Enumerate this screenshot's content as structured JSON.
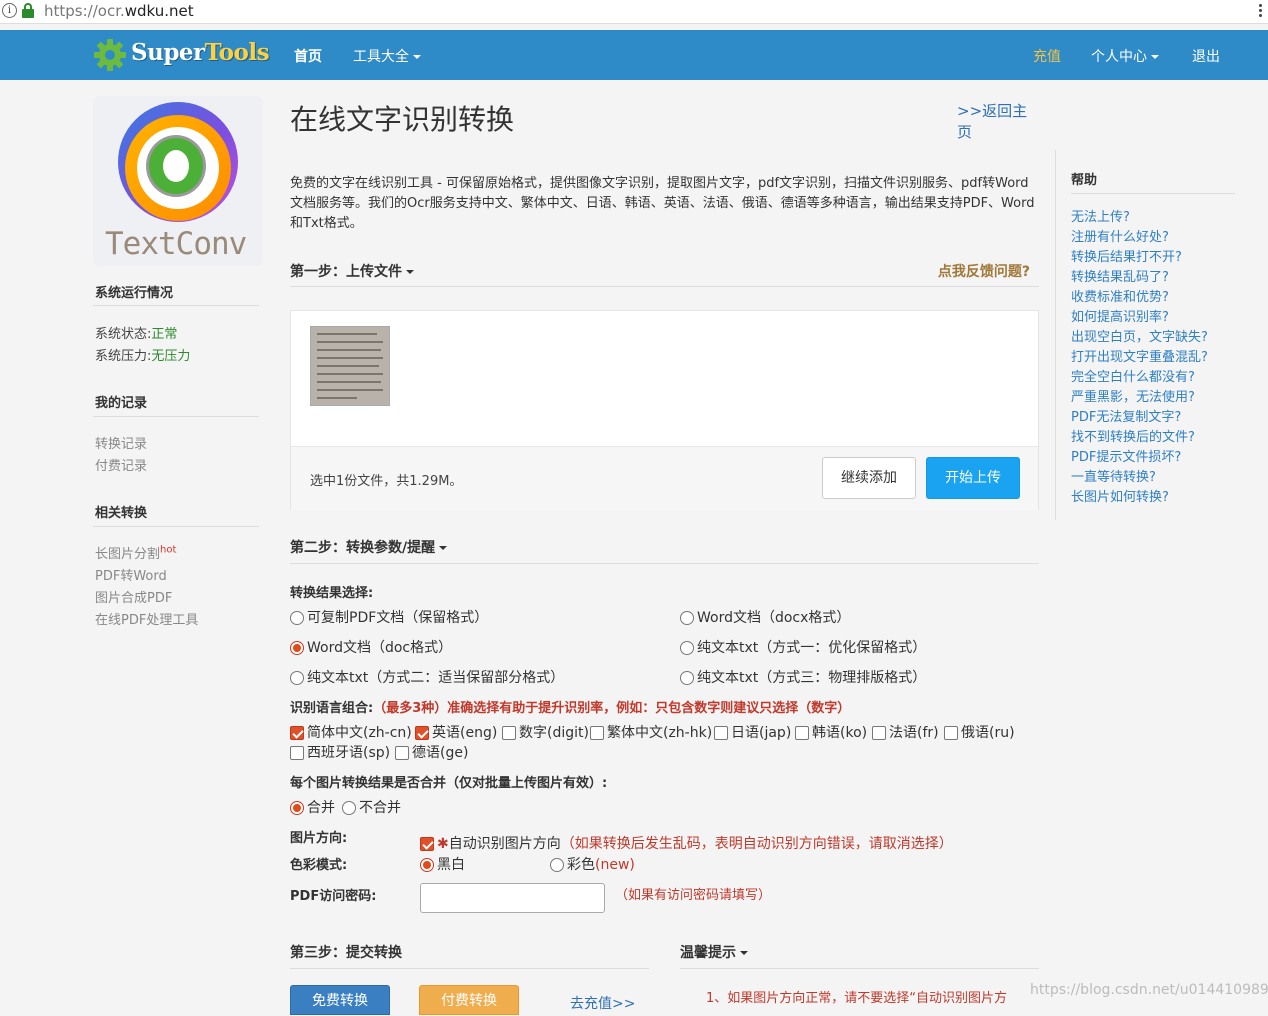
{
  "browser": {
    "url_prefix": "https://ocr.",
    "url_domain": "wdku.net"
  },
  "navbar": {
    "logo_part1": "Super",
    "logo_part2": "Tools",
    "home": "首页",
    "tools": "工具大全",
    "recharge": "充值",
    "personal": "个人中心",
    "logout": "退出",
    "bg_color": "#2e8bc7"
  },
  "sidebar": {
    "logo_text": "TextConv",
    "status_title": "系统运行情况",
    "status_label": "系统状态:",
    "status_value": "正常",
    "pressure_label": "系统压力:",
    "pressure_value": "无压力",
    "records_title": "我的记录",
    "records": [
      "转换记录",
      "付费记录"
    ],
    "related_title": "相关转换",
    "related": [
      "长图片分割",
      "PDF转Word",
      "图片合成PDF",
      "在线PDF处理工具"
    ],
    "hot_badge": "hot"
  },
  "main": {
    "title": "在线文字识别转换",
    "back_link": ">>返回主页",
    "intro": "免费的文字在线识别工具 - 可保留原始格式，提供图像文字识别，提取图片文字，pdf文字识别，扫描文件识别服务、pdf转Word文档服务等。我们的Ocr服务支持中文、繁体中文、日语、韩语、英语、法语、俄语、德语等多种语言，输出结果支持PDF、Word和Txt格式。",
    "step1": "第一步：上传文件",
    "feedback": "点我反馈问题?",
    "selected_files": "选中1份文件，共1.29M。",
    "btn_add": "继续添加",
    "btn_upload": "开始上传",
    "step2": "第二步：转换参数/提醒",
    "result_label": "转换结果选择:",
    "result_options": [
      "可复制PDF文档（保留格式）",
      "Word文档（docx格式）",
      "Word文档（doc格式）",
      "纯文本txt（方式一：优化保留格式）",
      "纯文本txt（方式二：适当保留部分格式）",
      "纯文本txt（方式三：物理排版格式）"
    ],
    "lang_label": "识别语言组合:",
    "lang_hint": "（最多3种）准确选择有助于提升识别率，例如：只包含数字则建议只选择（数字）",
    "languages": [
      "简体中文(zh-cn)",
      "英语(eng)",
      "数字(digit)",
      "繁体中文(zh-hk)",
      "日语(jap)",
      "韩语(ko)",
      "法语(fr)",
      "俄语(ru)",
      "西班牙语(sp)",
      "德语(ge)"
    ],
    "merge_label": "每个图片转换结果是否合并（仅对批量上传图片有效）:",
    "merge_yes": "合并",
    "merge_no": "不合并",
    "orient_label": "图片方向:",
    "orient_star": "✱",
    "orient_option": "自动识别图片方向",
    "orient_hint": "（如果转换后发生乱码，表明自动识别方向错误，请取消选择）",
    "color_label": "色彩模式:",
    "color_bw": "黑白",
    "color_color": "彩色",
    "color_new": "(new)",
    "pwd_label": "PDF访问密码:",
    "pwd_hint": "（如果有访问密码请填写）",
    "step3": "第三步：提交转换",
    "tips_title": "温馨提示",
    "btn_free": "免费转换",
    "btn_pay": "付费转换",
    "recharge_link": "去充值>>",
    "tip1": "1、如果图片方向正常，请不要选择“自动识别图片方"
  },
  "help": {
    "title": "帮助",
    "items": [
      "无法上传?",
      "注册有什么好处?",
      "转换后结果打不开?",
      "转换结果乱码了?",
      "收费标准和优势?",
      "如何提高识别率?",
      "出现空白页，文字缺失?",
      "打开出现文字重叠混乱?",
      "完全空白什么都没有?",
      "严重黑影，无法使用?",
      "PDF无法复制文字?",
      "找不到转换后的文件?",
      "PDF提示文件损坏?",
      "一直等待转换?",
      "长图片如何转换?"
    ]
  },
  "watermark": "https://blog.csdn.net/u014410989"
}
